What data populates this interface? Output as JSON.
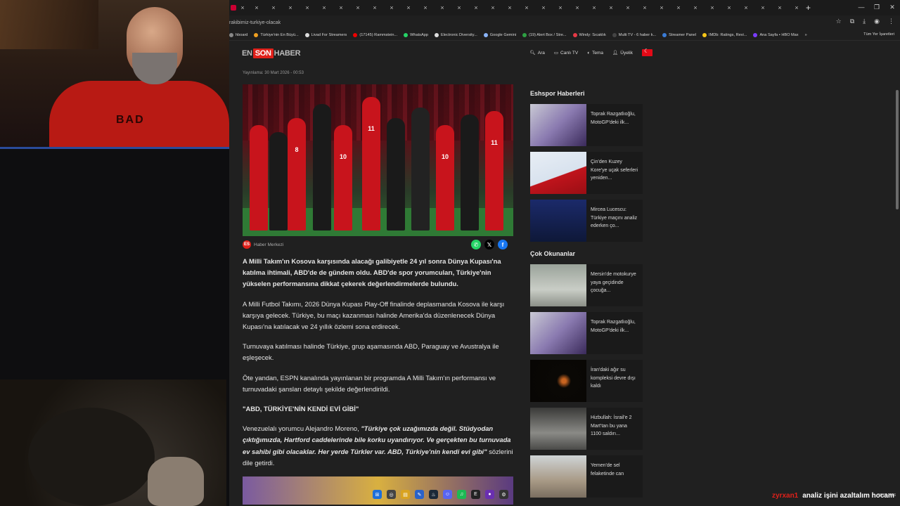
{
  "browser": {
    "url": "rakibimiz-turkiye-olacak",
    "tab_count": 34,
    "tab_close": "×",
    "new_tab": "+",
    "bookmarks": [
      {
        "label": "hboard",
        "color": "#888"
      },
      {
        "label": "Türkiye'nin En Büyü...",
        "color": "#f0a020"
      },
      {
        "label": "Livad For Streamers",
        "color": "#ddd"
      },
      {
        "label": "(17145) Rammstein...",
        "color": "#e00"
      },
      {
        "label": "WhatsApp",
        "color": "#25d366"
      },
      {
        "label": "Electronic Diversity...",
        "color": "#ddd"
      },
      {
        "label": "Google Gemini",
        "color": "#8ab4f8"
      },
      {
        "label": "(19) Alert Box / Stre...",
        "color": "#2ea043"
      },
      {
        "label": "Windy: Sıcaklık",
        "color": "#e63946"
      },
      {
        "label": "Multi TV - 6 haber k...",
        "color": "#444"
      },
      {
        "label": "Streamer Panel",
        "color": "#3a7bd5"
      },
      {
        "label": "IMDb: Ratings, Revi...",
        "color": "#f5c518"
      },
      {
        "label": "Ana Sayfa • HBO Max",
        "color": "#7a3cff"
      }
    ],
    "bookmarks_more": "»",
    "bookmarks_all": "Tüm Yer İşaretleri"
  },
  "site": {
    "logo_en": "EN",
    "logo_son": "SON",
    "logo_haber": "HABER",
    "nav": {
      "search": "Ara",
      "live_tv": "Canlı TV",
      "theme": "Tema",
      "membership": "Üyelik"
    }
  },
  "article": {
    "published": "Yayınlama: 30 Mart 2026 - 00:53",
    "source": "Haber Merkezi",
    "jersey_numbers": [
      "8",
      "10",
      "11",
      "10",
      "11"
    ],
    "lead": "A Milli Takım'ın Kosova karşısında alacağı galibiyetle 24 yıl sonra Dünya Kupası'na katılma ihtimali, ABD'de de gündem oldu. ABD'de spor yorumcuları, Türkiye'nin yükselen performansına dikkat çekerek değerlendirmelerde bulundu.",
    "p1": "A Milli Futbol Takımı, 2026 Dünya Kupası Play-Off finalinde deplasmanda Kosova ile karşı karşıya gelecek. Türkiye, bu maçı kazanması halinde Amerika'da düzenlenecek Dünya Kupası'na katılacak ve 24 yıllık özlemi sona erdirecek.",
    "p2": "Turnuvaya katılması halinde Türkiye, grup aşamasında ABD, Paraguay ve Avustralya ile eşleşecek.",
    "p3": "Öte yandan, ESPN kanalında yayınlanan bir programda A Milli Takım'ın performansı ve turnuvadaki şansları detaylı şekilde değerlendirildi.",
    "subheading": "\"ABD, TÜRKİYE'NİN KENDİ EVİ GİBİ\"",
    "p4_start": "Venezuelalı yorumcu Alejandro Moreno, ",
    "p4_quote": "\"Türkiye çok uzağımızda değil. Stüdyodan çıktığımızda, Hartford caddelerinde bile korku uyandırıyor. Ve gerçekten bu turnuvada ev sahibi gibi olacaklar. Her yerde Türkler var. ABD, Türkiye'nin kendi evi gibi\"",
    "p4_end": " sözlerini dile getirdi."
  },
  "sidebar": {
    "section1_title": "Eshspor Haberleri",
    "section1": [
      {
        "title": "Toprak Razgatlıoğlu, MotoGP'deki ilk...",
        "img": "moto"
      },
      {
        "title": "Çin'den Kuzey Kore'ye uçak seferleri yeniden...",
        "img": "plane"
      },
      {
        "title": "Mircea Lucescu: Türkiye maçını analiz ederken ço...",
        "img": "coach"
      }
    ],
    "section2_title": "Çok Okunanlar",
    "section2": [
      {
        "title": "Mersin'de motokurye yaya geçidinde çocuğa...",
        "img": "street"
      },
      {
        "title": "Toprak Razgatlıoğlu, MotoGP'deki ilk...",
        "img": "moto"
      },
      {
        "title": "İran'daki ağır su kompleksi devre dışı kaldı",
        "img": "night"
      },
      {
        "title": "Hizbullah: İsrail'e 2 Mart'tan bu yana 1100 saldırı...",
        "img": "smoke"
      },
      {
        "title": "Yemen'de sel felaketinde can",
        "img": "flood"
      }
    ]
  },
  "overlay": {
    "cam_shirt_text": "BAD",
    "chat_user": "zyrxan1",
    "chat_msg": "analiz işini azaltalım hocam",
    "date": "30.03.2026"
  }
}
